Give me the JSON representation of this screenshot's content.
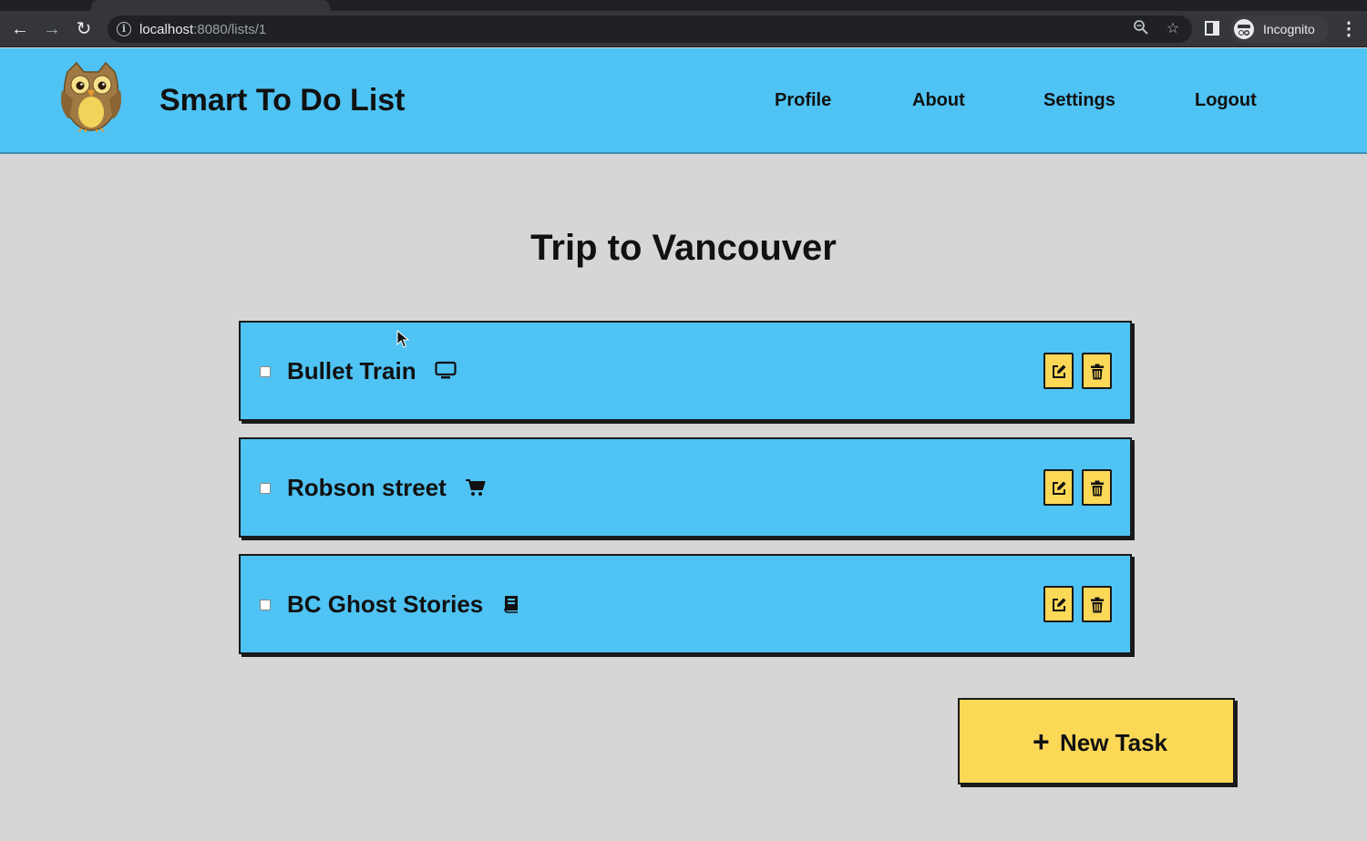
{
  "browser": {
    "url_host": "localhost",
    "url_path": ":8080/lists/1",
    "profile_label": "Incognito",
    "icons": [
      "back-icon",
      "forward-icon",
      "reload-icon",
      "info-icon",
      "zoom-icon",
      "bookmark-star-icon",
      "side-panel-icon",
      "incognito-icon",
      "more-menu-icon"
    ]
  },
  "header": {
    "app_title": "Smart To Do List",
    "nav": [
      "Profile",
      "About",
      "Settings",
      "Logout"
    ],
    "logo": "owl-logo"
  },
  "list": {
    "title": "Trip to Vancouver",
    "tasks": [
      {
        "title": "Bullet Train",
        "category_icon": "tv-icon",
        "completed": false
      },
      {
        "title": "Robson street",
        "category_icon": "shopping-cart-icon",
        "completed": false
      },
      {
        "title": "BC Ghost Stories",
        "category_icon": "book-icon",
        "completed": false
      }
    ],
    "new_task_label": "New Task"
  },
  "colors": {
    "header_bg": "#4fc3f4",
    "task_bg": "#4fc3f4",
    "button_yellow": "#fcd857",
    "page_bg": "#d6d6d6"
  }
}
